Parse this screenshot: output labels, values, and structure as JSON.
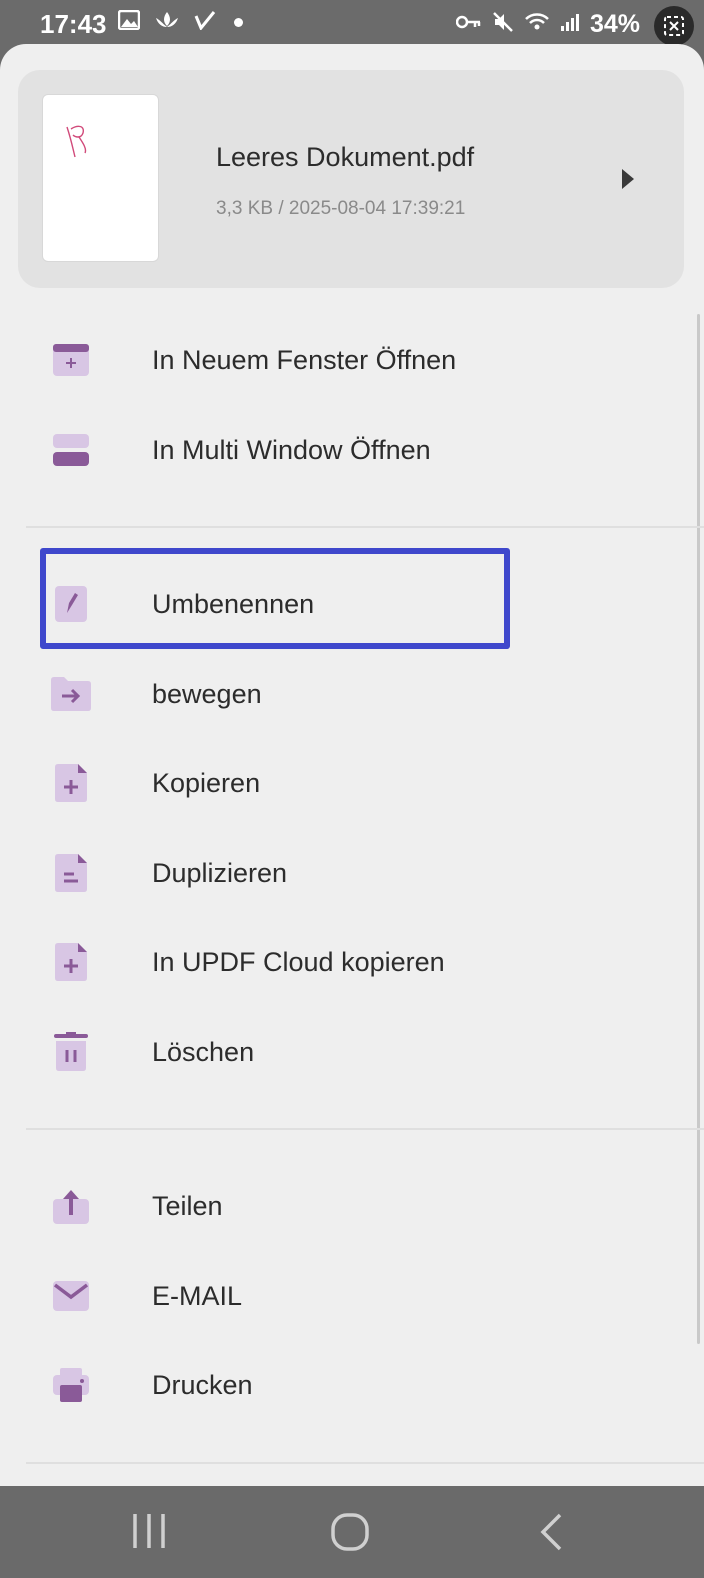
{
  "status_bar": {
    "time": "17:43",
    "battery": "34%",
    "icons": [
      "image-icon",
      "lotus-icon",
      "check-icon",
      "key-icon",
      "mute-icon",
      "wifi-icon",
      "signal-icon",
      "battery-icon"
    ]
  },
  "file": {
    "name": "Leeres Dokument.pdf",
    "meta": "3,3 KB / 2025-08-04 17:39:21"
  },
  "colors": {
    "icon_light": "#d8c6e4",
    "icon_dark": "#8a5a98",
    "highlight": "#3f48cc"
  },
  "menu": {
    "open_new_window": "In Neuem Fenster Öffnen",
    "open_multi_window": "In Multi Window Öffnen",
    "rename": "Umbenennen",
    "move": "bewegen",
    "copy": "Kopieren",
    "duplicate": "Duplizieren",
    "copy_cloud": "In UPDF Cloud kopieren",
    "delete": "Löschen",
    "share": "Teilen",
    "email": "E-MAIL",
    "print": "Drucken"
  }
}
